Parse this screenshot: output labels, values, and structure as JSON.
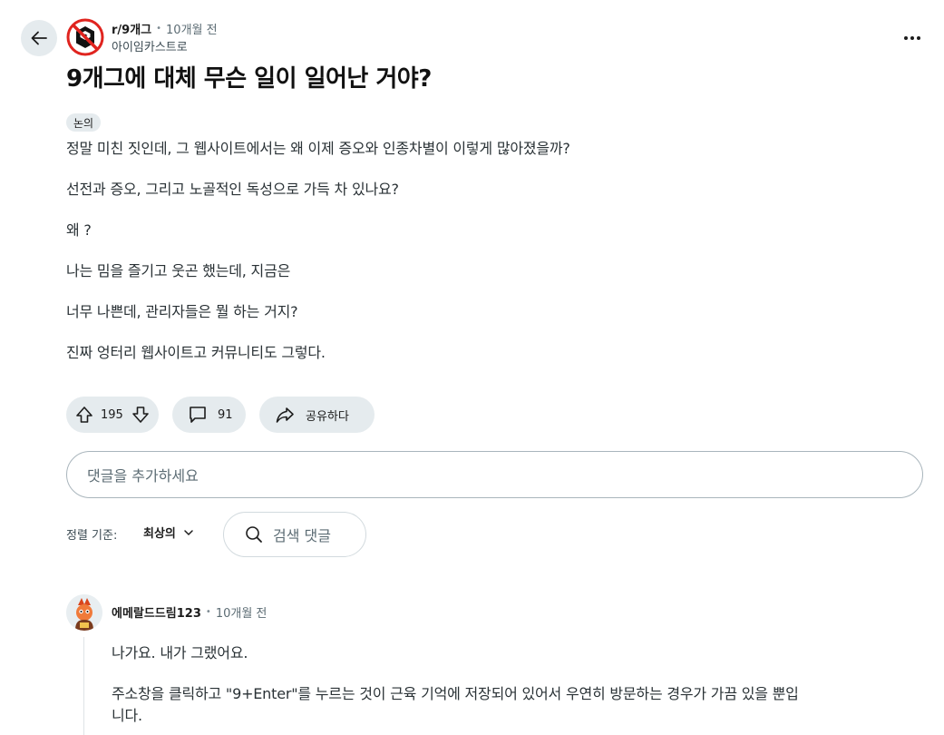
{
  "header": {
    "subreddit": "r/9개그",
    "separator": "•",
    "time_ago": "10개월 전",
    "author": "아이임카스트로",
    "back_icon": "arrow-left-icon",
    "more_icon": "more-horizontal-icon"
  },
  "post": {
    "title": "9개그에 대체 무슨 일이 일어난 거야?",
    "flair": "논의",
    "paragraphs": [
      "정말 미친 짓인데, 그 웹사이트에서는 왜 이제 증오와 인종차별이 이렇게 많아졌을까?",
      "선전과 증오, 그리고 노골적인 독성으로 가득 차 있나요?",
      "왜 ?",
      "나는 밈을 즐기고 웃곤 했는데, 지금은",
      "너무 나쁜데, 관리자들은 뭘 하는 거지?",
      "진짜 엉터리 웹사이트고 커뮤니티도 그렇다."
    ]
  },
  "actions": {
    "upvotes": "195",
    "comments": "91",
    "share_label": "공유하다"
  },
  "comment_input": {
    "placeholder": "댓글을 추가하세요"
  },
  "sort": {
    "label": "정렬 기준:",
    "value": "최상의"
  },
  "search_comments": {
    "placeholder": "검색 댓글"
  },
  "comments": [
    {
      "username": "에메랄드드림123",
      "separator": "•",
      "time_ago": "10개월 전",
      "lines": [
        "나가요. 내가 그랬어요.",
        "주소창을 클릭하고 \"9+Enter\"를 누르는 것이 근육 기억에 저장되어 있어서 우연히 방문하는 경우가 가끔 있을 뿐입",
        "니다."
      ]
    }
  ],
  "colors": {
    "pill_bg": "#e5ebee",
    "subreddit_icon_red": "#e0241f",
    "text": "#1c1c1c",
    "muted": "#5c6c74"
  }
}
